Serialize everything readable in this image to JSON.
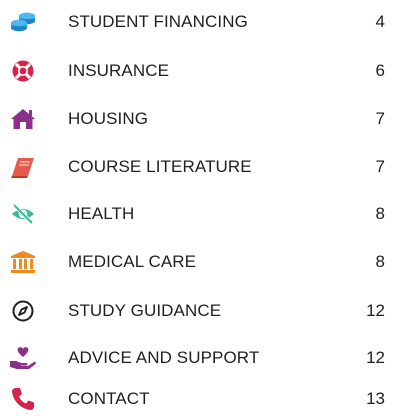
{
  "toc": {
    "entries": [
      {
        "label": "STUDENT FINANCING",
        "page": "4",
        "icon": "coins-stack-icon",
        "color": "#2aa1e6"
      },
      {
        "label": "INSURANCE",
        "page": "6",
        "icon": "lifebuoy-icon",
        "color": "#d5234b"
      },
      {
        "label": "HOUSING",
        "page": "7",
        "icon": "house-icon",
        "color": "#8c2f8c"
      },
      {
        "label": "COURSE LITERATURE",
        "page": "7",
        "icon": "book-icon",
        "color": "#e65b4f"
      },
      {
        "label": "HEALTH",
        "page": "8",
        "icon": "eye-slash-icon",
        "color": "#3cb99a"
      },
      {
        "label": "MEDICAL CARE",
        "page": "8",
        "icon": "institution-icon",
        "color": "#ef8a1d"
      },
      {
        "label": "STUDY GUIDANCE",
        "page": "12",
        "icon": "compass-icon",
        "color": "#1f1f1f"
      },
      {
        "label": "ADVICE AND SUPPORT",
        "page": "12",
        "icon": "hand-heart-icon",
        "color": "#8c2f8c"
      },
      {
        "label": "CONTACT",
        "page": "13",
        "icon": "phone-icon",
        "color": "#d5234b"
      }
    ]
  }
}
